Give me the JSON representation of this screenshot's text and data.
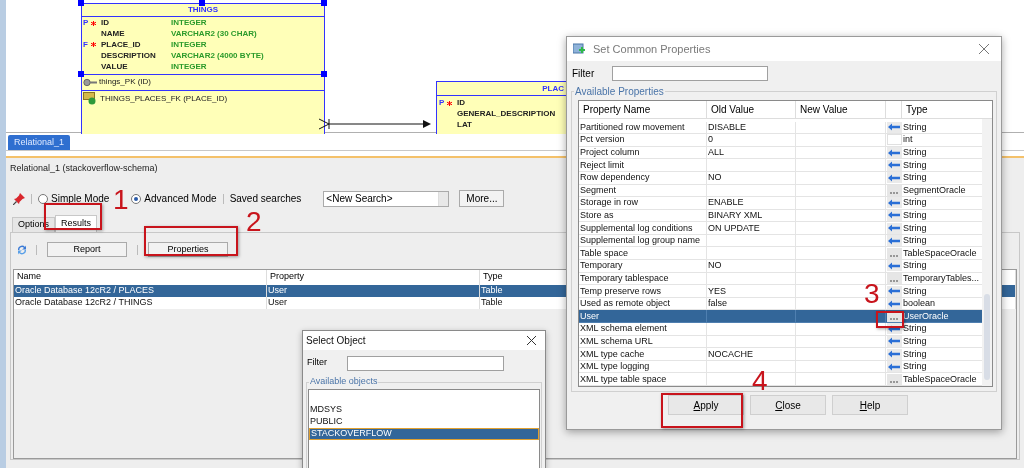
{
  "diagram": {
    "tables": [
      {
        "title": "THINGS",
        "selected": true,
        "columns": [
          {
            "key": "P",
            "required": true,
            "name": "ID",
            "type": "INTEGER"
          },
          {
            "required": false,
            "name": "NAME",
            "type": "VARCHAR2 (30 CHAR)"
          },
          {
            "key": "F",
            "required": true,
            "name": "PLACE_ID",
            "type": "INTEGER"
          },
          {
            "required": false,
            "name": "DESCRIPTION",
            "type": "VARCHAR2 (4000 BYTE)"
          },
          {
            "required": false,
            "name": "VALUE",
            "type": "INTEGER"
          }
        ],
        "primary_key": "things_PK (ID)",
        "foreign_keys": [
          "THINGS_PLACES_FK (PLACE_ID)"
        ]
      },
      {
        "title": "PLAC",
        "selected": false,
        "columns": [
          {
            "key": "P",
            "required": true,
            "name": "ID"
          },
          {
            "required": false,
            "name": "GENERAL_DESCRIPTION"
          },
          {
            "required": false,
            "name": "LAT"
          }
        ]
      }
    ]
  },
  "diagram_tabs": [
    {
      "label": "Relational_1",
      "selected": true
    }
  ],
  "panel": {
    "title": "Relational_1 (stackoverflow-schema)",
    "modes": [
      {
        "label": "Simple Mode",
        "selected": false
      },
      {
        "label": "Advanced Mode",
        "selected": true
      }
    ],
    "saved_searches_label": "Saved searches",
    "saved_search": "<New Search>",
    "more_button": "More...",
    "tabs": [
      {
        "label": "Options",
        "selected": false
      },
      {
        "label": "Results",
        "selected": true
      }
    ],
    "buttons": [
      "Report",
      "Properties"
    ],
    "table": {
      "columns": [
        "Name",
        "Property",
        "Type"
      ],
      "rows": [
        {
          "cells": [
            "Oracle Database 12cR2 / PLACES",
            "User",
            "Table"
          ],
          "selected": true
        },
        {
          "cells": [
            "Oracle Database 12cR2 / THINGS",
            "User",
            "Table"
          ],
          "selected": false
        }
      ]
    }
  },
  "common_properties_dialog": {
    "title": "Set Common Properties",
    "filter_label": "Filter",
    "group_label": "Available Properties",
    "columns": [
      "Property Name",
      "Old Value",
      "New Value",
      "Type"
    ],
    "rows": [
      {
        "name": "Partitioned row movement",
        "old_value": "DISABLE",
        "kind": "arrow",
        "type": "String",
        "selected": false
      },
      {
        "name": "Pct version",
        "old_value": "0",
        "kind": "blank",
        "type": "int",
        "selected": false
      },
      {
        "name": "Project column",
        "old_value": "ALL",
        "kind": "arrow",
        "type": "String",
        "selected": false
      },
      {
        "name": "Reject limit",
        "old_value": "",
        "kind": "arrow",
        "type": "String",
        "selected": false
      },
      {
        "name": "Row dependency",
        "old_value": "NO",
        "kind": "arrow",
        "type": "String",
        "selected": false
      },
      {
        "name": "Segment",
        "old_value": "",
        "kind": "ellipsis",
        "type": "SegmentOracle",
        "selected": false
      },
      {
        "name": "Storage in row",
        "old_value": "ENABLE",
        "kind": "arrow",
        "type": "String",
        "selected": false
      },
      {
        "name": "Store as",
        "old_value": "BINARY XML",
        "kind": "arrow",
        "type": "String",
        "selected": false
      },
      {
        "name": "Supplemental log conditions",
        "old_value": "ON UPDATE",
        "kind": "arrow",
        "type": "String",
        "selected": false
      },
      {
        "name": "Supplemental log group name",
        "old_value": "",
        "kind": "arrow",
        "type": "String",
        "selected": false
      },
      {
        "name": "Table space",
        "old_value": "",
        "kind": "ellipsis",
        "type": "TableSpaceOracle",
        "selected": false
      },
      {
        "name": "Temporary",
        "old_value": "NO",
        "kind": "arrow",
        "type": "String",
        "selected": false
      },
      {
        "name": "Temporary tablespace",
        "old_value": "",
        "kind": "ellipsis",
        "type": "TemporaryTables...",
        "selected": false
      },
      {
        "name": "Temp preserve rows",
        "old_value": "YES",
        "kind": "arrow",
        "type": "String",
        "selected": false
      },
      {
        "name": "Used as remote object",
        "old_value": "false",
        "kind": "arrow",
        "type": "boolean",
        "selected": false
      },
      {
        "name": "User",
        "old_value": "",
        "kind": "ellipsis",
        "type": "UserOracle",
        "selected": true
      },
      {
        "name": "XML schema element",
        "old_value": "",
        "kind": "arrow",
        "type": "String",
        "selected": false
      },
      {
        "name": "XML schema URL",
        "old_value": "",
        "kind": "arrow",
        "type": "String",
        "selected": false
      },
      {
        "name": "XML type cache",
        "old_value": "NOCACHE",
        "kind": "arrow",
        "type": "String",
        "selected": false
      },
      {
        "name": "XML type logging",
        "old_value": "",
        "kind": "arrow",
        "type": "String",
        "selected": false
      },
      {
        "name": "XML type table space",
        "old_value": "",
        "kind": "ellipsis",
        "type": "TableSpaceOracle",
        "selected": false
      }
    ],
    "buttons": [
      "Apply",
      "Close",
      "Help"
    ]
  },
  "select_object_dialog": {
    "title": "Select Object",
    "filter_label": "Filter",
    "group_label": "Available objects",
    "items": [
      {
        "label": "MDSYS",
        "selected": false
      },
      {
        "label": "PUBLIC",
        "selected": false
      },
      {
        "label": "STACKOVERFLOW",
        "selected": true
      }
    ]
  },
  "annotations": [
    {
      "label": "1"
    },
    {
      "label": "2"
    },
    {
      "label": "3"
    },
    {
      "label": "4"
    }
  ]
}
